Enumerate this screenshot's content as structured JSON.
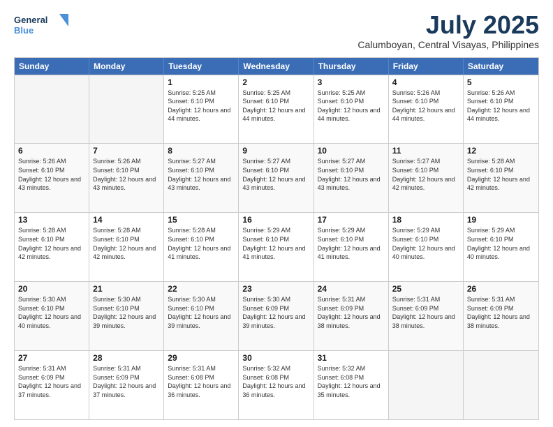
{
  "logo": {
    "line1": "General",
    "line2": "Blue"
  },
  "header": {
    "month": "July 2025",
    "location": "Calumboyan, Central Visayas, Philippines"
  },
  "weekdays": [
    "Sunday",
    "Monday",
    "Tuesday",
    "Wednesday",
    "Thursday",
    "Friday",
    "Saturday"
  ],
  "rows": [
    {
      "cells": [
        {
          "day": "",
          "info": "",
          "empty": true
        },
        {
          "day": "",
          "info": "",
          "empty": true
        },
        {
          "day": "1",
          "info": "Sunrise: 5:25 AM\nSunset: 6:10 PM\nDaylight: 12 hours and 44 minutes."
        },
        {
          "day": "2",
          "info": "Sunrise: 5:25 AM\nSunset: 6:10 PM\nDaylight: 12 hours and 44 minutes."
        },
        {
          "day": "3",
          "info": "Sunrise: 5:25 AM\nSunset: 6:10 PM\nDaylight: 12 hours and 44 minutes."
        },
        {
          "day": "4",
          "info": "Sunrise: 5:26 AM\nSunset: 6:10 PM\nDaylight: 12 hours and 44 minutes."
        },
        {
          "day": "5",
          "info": "Sunrise: 5:26 AM\nSunset: 6:10 PM\nDaylight: 12 hours and 44 minutes."
        }
      ]
    },
    {
      "cells": [
        {
          "day": "6",
          "info": "Sunrise: 5:26 AM\nSunset: 6:10 PM\nDaylight: 12 hours and 43 minutes."
        },
        {
          "day": "7",
          "info": "Sunrise: 5:26 AM\nSunset: 6:10 PM\nDaylight: 12 hours and 43 minutes."
        },
        {
          "day": "8",
          "info": "Sunrise: 5:27 AM\nSunset: 6:10 PM\nDaylight: 12 hours and 43 minutes."
        },
        {
          "day": "9",
          "info": "Sunrise: 5:27 AM\nSunset: 6:10 PM\nDaylight: 12 hours and 43 minutes."
        },
        {
          "day": "10",
          "info": "Sunrise: 5:27 AM\nSunset: 6:10 PM\nDaylight: 12 hours and 43 minutes."
        },
        {
          "day": "11",
          "info": "Sunrise: 5:27 AM\nSunset: 6:10 PM\nDaylight: 12 hours and 42 minutes."
        },
        {
          "day": "12",
          "info": "Sunrise: 5:28 AM\nSunset: 6:10 PM\nDaylight: 12 hours and 42 minutes."
        }
      ]
    },
    {
      "cells": [
        {
          "day": "13",
          "info": "Sunrise: 5:28 AM\nSunset: 6:10 PM\nDaylight: 12 hours and 42 minutes."
        },
        {
          "day": "14",
          "info": "Sunrise: 5:28 AM\nSunset: 6:10 PM\nDaylight: 12 hours and 42 minutes."
        },
        {
          "day": "15",
          "info": "Sunrise: 5:28 AM\nSunset: 6:10 PM\nDaylight: 12 hours and 41 minutes."
        },
        {
          "day": "16",
          "info": "Sunrise: 5:29 AM\nSunset: 6:10 PM\nDaylight: 12 hours and 41 minutes."
        },
        {
          "day": "17",
          "info": "Sunrise: 5:29 AM\nSunset: 6:10 PM\nDaylight: 12 hours and 41 minutes."
        },
        {
          "day": "18",
          "info": "Sunrise: 5:29 AM\nSunset: 6:10 PM\nDaylight: 12 hours and 40 minutes."
        },
        {
          "day": "19",
          "info": "Sunrise: 5:29 AM\nSunset: 6:10 PM\nDaylight: 12 hours and 40 minutes."
        }
      ]
    },
    {
      "cells": [
        {
          "day": "20",
          "info": "Sunrise: 5:30 AM\nSunset: 6:10 PM\nDaylight: 12 hours and 40 minutes."
        },
        {
          "day": "21",
          "info": "Sunrise: 5:30 AM\nSunset: 6:10 PM\nDaylight: 12 hours and 39 minutes."
        },
        {
          "day": "22",
          "info": "Sunrise: 5:30 AM\nSunset: 6:10 PM\nDaylight: 12 hours and 39 minutes."
        },
        {
          "day": "23",
          "info": "Sunrise: 5:30 AM\nSunset: 6:09 PM\nDaylight: 12 hours and 39 minutes."
        },
        {
          "day": "24",
          "info": "Sunrise: 5:31 AM\nSunset: 6:09 PM\nDaylight: 12 hours and 38 minutes."
        },
        {
          "day": "25",
          "info": "Sunrise: 5:31 AM\nSunset: 6:09 PM\nDaylight: 12 hours and 38 minutes."
        },
        {
          "day": "26",
          "info": "Sunrise: 5:31 AM\nSunset: 6:09 PM\nDaylight: 12 hours and 38 minutes."
        }
      ]
    },
    {
      "cells": [
        {
          "day": "27",
          "info": "Sunrise: 5:31 AM\nSunset: 6:09 PM\nDaylight: 12 hours and 37 minutes."
        },
        {
          "day": "28",
          "info": "Sunrise: 5:31 AM\nSunset: 6:09 PM\nDaylight: 12 hours and 37 minutes."
        },
        {
          "day": "29",
          "info": "Sunrise: 5:31 AM\nSunset: 6:08 PM\nDaylight: 12 hours and 36 minutes."
        },
        {
          "day": "30",
          "info": "Sunrise: 5:32 AM\nSunset: 6:08 PM\nDaylight: 12 hours and 36 minutes."
        },
        {
          "day": "31",
          "info": "Sunrise: 5:32 AM\nSunset: 6:08 PM\nDaylight: 12 hours and 35 minutes."
        },
        {
          "day": "",
          "info": "",
          "empty": true
        },
        {
          "day": "",
          "info": "",
          "empty": true
        }
      ]
    }
  ]
}
